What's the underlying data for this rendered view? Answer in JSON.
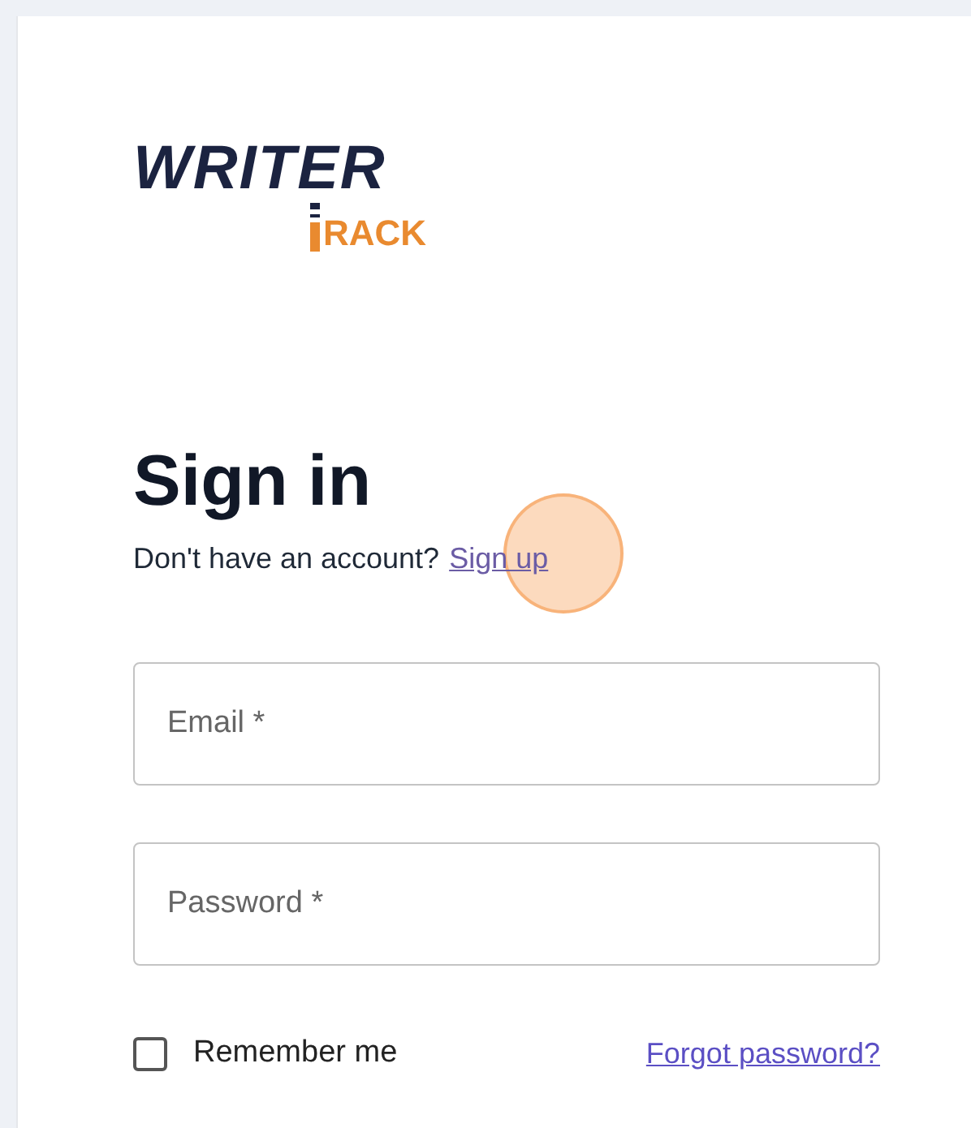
{
  "logo": {
    "top_word": "WRITER",
    "bottom_word": "RACK"
  },
  "heading": "Sign in",
  "prompt": {
    "text": "Don't have an account?",
    "link": "Sign up"
  },
  "fields": [
    {
      "placeholder": "Email *"
    },
    {
      "placeholder": "Password *"
    }
  ],
  "remember": {
    "label": "Remember me",
    "checked": false
  },
  "forgot_link": "Forgot password?"
}
